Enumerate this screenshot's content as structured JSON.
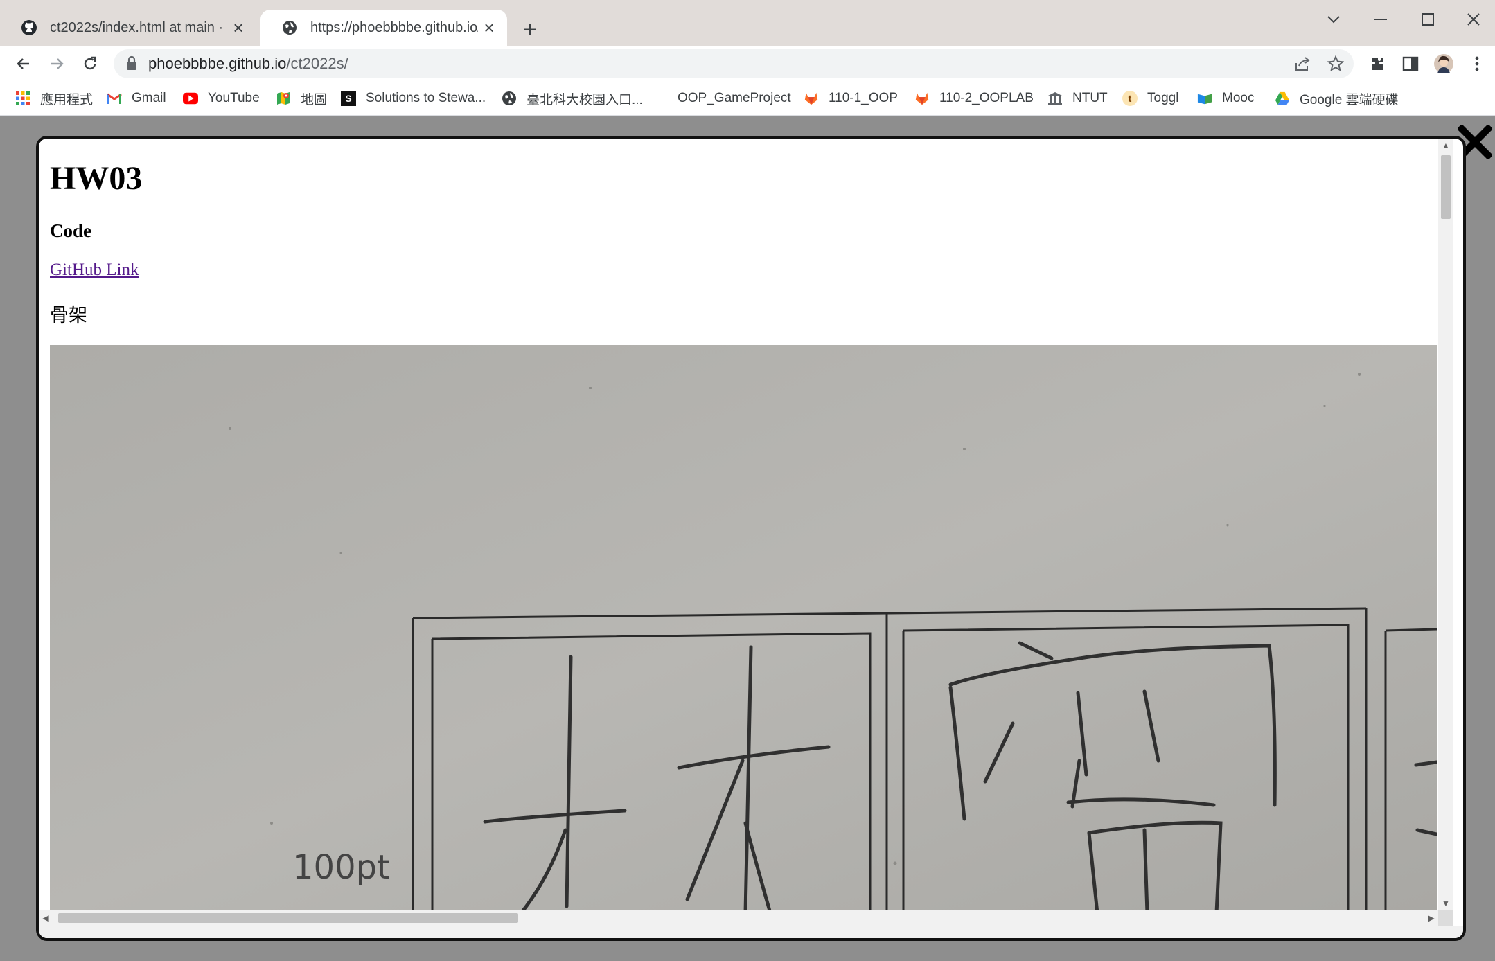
{
  "browser": {
    "tabs": [
      {
        "title": "ct2022s/index.html at main · ph",
        "icon": "github-icon"
      },
      {
        "title": "https://phoebbbbe.github.io/ct",
        "icon": "globe-icon"
      }
    ],
    "new_tab": "+",
    "url_host": "phoebbbbe.github.io",
    "url_path": "/ct2022s/",
    "bookmarks": [
      {
        "label": "應用程式",
        "icon": "apps-grid-icon"
      },
      {
        "label": "Gmail",
        "icon": "gmail-icon"
      },
      {
        "label": "YouTube",
        "icon": "youtube-icon"
      },
      {
        "label": "地圖",
        "icon": "maps-icon"
      },
      {
        "label": "Solutions to Stewa...",
        "icon": "s-icon"
      },
      {
        "label": "臺北科大校園入口...",
        "icon": "globe-icon"
      },
      {
        "label": "OOP_GameProject",
        "icon": ""
      },
      {
        "label": "110-1_OOP",
        "icon": "gitlab-icon"
      },
      {
        "label": "110-2_OOPLAB",
        "icon": "gitlab-icon"
      },
      {
        "label": "NTUT",
        "icon": "building-icon"
      },
      {
        "label": "Toggl",
        "icon": "toggl-icon"
      },
      {
        "label": "Mooc",
        "icon": "mooc-icon"
      },
      {
        "label": "Google 雲端硬碟",
        "icon": "drive-icon"
      }
    ]
  },
  "page": {
    "title": "HW03",
    "code_heading": "Code",
    "github_link": "GitHub Link",
    "skeleton_heading": "骨架",
    "photo_label": "100pt"
  },
  "colors": {
    "titlebar": "#e1dcd9",
    "overlay": "#8e8e8e",
    "link": "#551a8b",
    "photo_bg": "#b3b2ae"
  }
}
